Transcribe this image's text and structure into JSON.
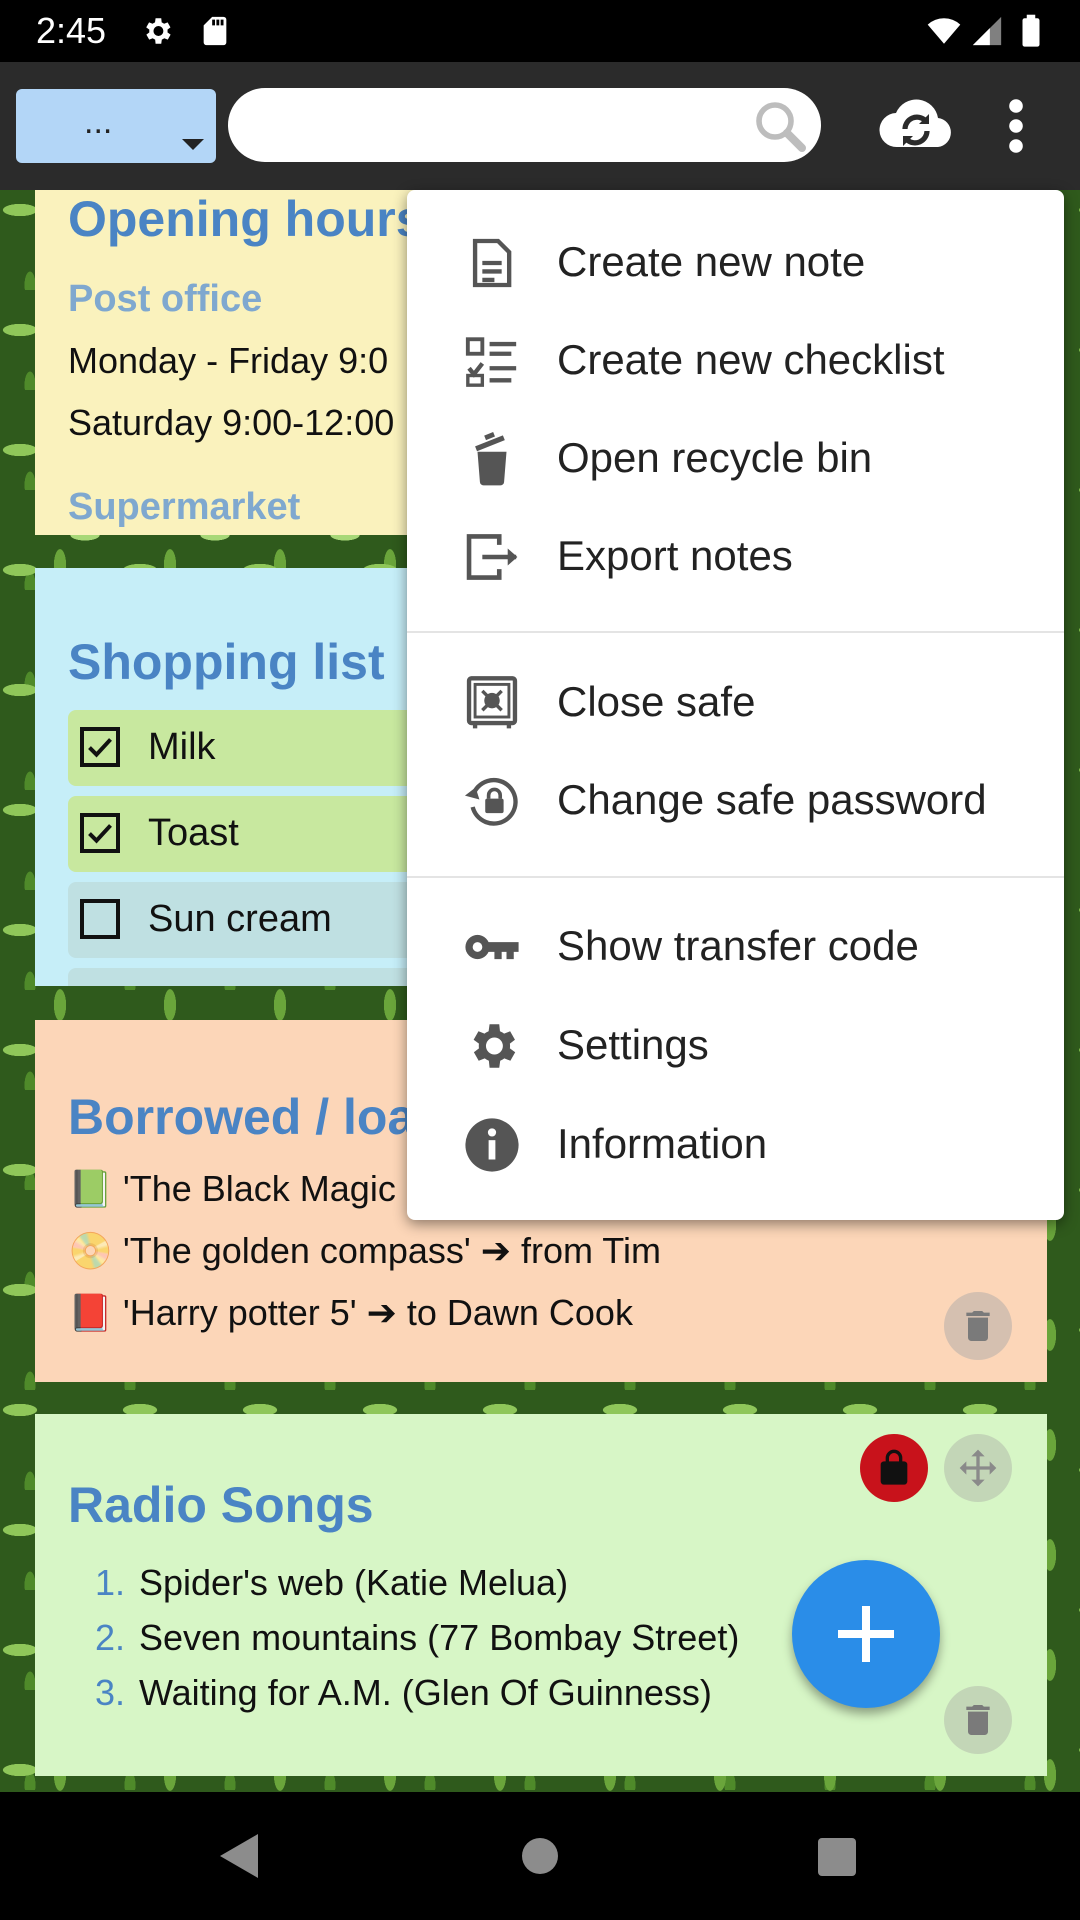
{
  "status_bar": {
    "time": "2:45",
    "icons": [
      "gear-icon",
      "sd-card-icon",
      "wifi-icon",
      "signal-icon",
      "battery-icon"
    ]
  },
  "toolbar": {
    "filter_label": "...",
    "search_placeholder": "",
    "icons": [
      "search-icon",
      "cloud-sync-icon",
      "more-vert-icon"
    ]
  },
  "notes": {
    "opening_hours": {
      "title": "Opening hours",
      "post_office": "Post office",
      "line1": "Monday - Friday 9:0",
      "line2": "Saturday 9:00-12:00",
      "supermarket": "Supermarket"
    },
    "shopping_list": {
      "title": "Shopping list",
      "items": [
        {
          "label": "Milk",
          "checked": true
        },
        {
          "label": "Toast",
          "checked": true
        },
        {
          "label": "Sun cream",
          "checked": false
        }
      ]
    },
    "borrowed": {
      "title": "Borrowed / loa",
      "lines": [
        {
          "emoji": "📗",
          "text": "'The Black Magic"
        },
        {
          "emoji": "📀",
          "text": "'The golden compass' ➔ from Tim"
        },
        {
          "emoji": "📕",
          "text": "'Harry potter 5' ➔ to Dawn Cook"
        }
      ]
    },
    "radio_songs": {
      "title": "Radio Songs",
      "items": [
        {
          "num": "1.",
          "text": "Spider's web (Katie Melua)"
        },
        {
          "num": "2.",
          "text": "Seven mountains (77 Bombay Street)"
        },
        {
          "num": "3.",
          "text": "Waiting for A.M. (Glen Of Guinness)"
        }
      ]
    }
  },
  "menu": {
    "items": [
      {
        "label": "Create new note",
        "icon": "note-icon"
      },
      {
        "label": "Create new checklist",
        "icon": "checklist-icon"
      },
      {
        "label": "Open recycle bin",
        "icon": "recycle-bin-icon"
      },
      {
        "label": "Export notes",
        "icon": "export-icon"
      },
      {
        "label": "Close safe",
        "icon": "safe-icon"
      },
      {
        "label": "Change safe password",
        "icon": "lock-reset-icon"
      },
      {
        "label": "Show transfer code",
        "icon": "key-icon"
      },
      {
        "label": "Settings",
        "icon": "gear-icon"
      },
      {
        "label": "Information",
        "icon": "info-icon"
      }
    ]
  },
  "colors": {
    "accent": "#2a8de8",
    "title_blue": "#4a84c4",
    "lock_red": "#c8121b"
  }
}
